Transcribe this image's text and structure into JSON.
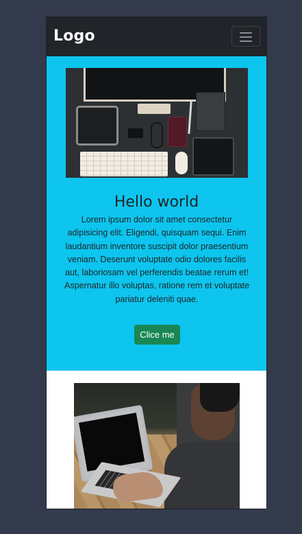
{
  "navbar": {
    "logo": "Logo",
    "toggle_icon": "hamburger-menu-icon"
  },
  "hero": {
    "image_alt": "Desk workspace with monitor, keyboard, tablet and accessories",
    "title": "Hello world",
    "text": "Lorem ipsum dolor sit amet consectetur adipisicing elit. Eligendi, quisquam sequi. Enim laudantium inventore suscipit dolor praesentium veniam. Deserunt voluptate odio dolores facilis aut, laboriosam vel perferendis beatae rerum et! Aspernatur illo voluptas, ratione rem et voluptate pariatur deleniti quae.",
    "button_label": "Clice me",
    "background_color": "#0dc5ee",
    "button_color": "#198754"
  },
  "content": {
    "image_alt": "Person typing on a laptop on a wooden table"
  },
  "colors": {
    "page_background": "#333a4b",
    "navbar_background": "#212529",
    "content_background": "#ffffff"
  }
}
